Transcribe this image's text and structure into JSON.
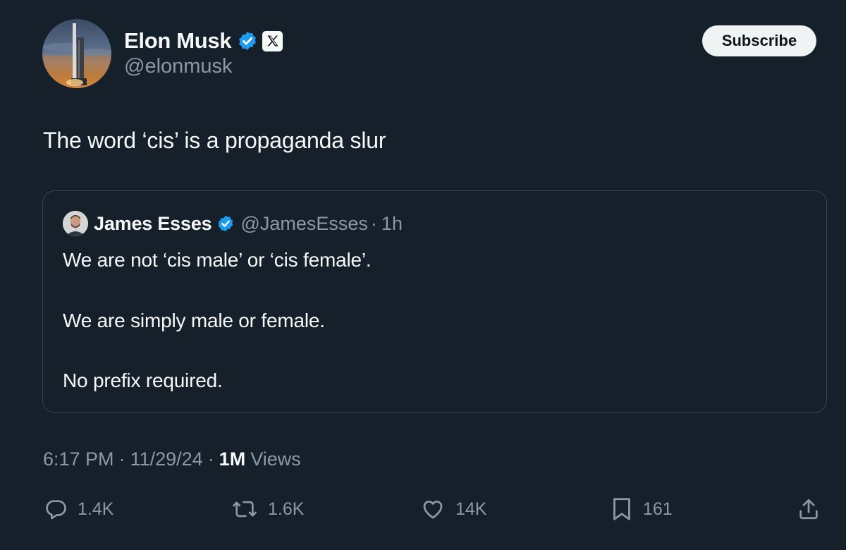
{
  "author": {
    "display_name": "Elon Musk",
    "handle": "@elonmusk",
    "verified_icon": "verified-badge-icon",
    "affiliate_icon": "x-logo-icon"
  },
  "subscribe_label": "Subscribe",
  "tweet": {
    "text": "The word ‘cis’ is a propaganda slur"
  },
  "quote": {
    "display_name": "James Esses",
    "handle": "@JamesEsses",
    "separator": "·",
    "time": "1h",
    "lines": [
      "We are not ‘cis male’ or ‘cis female’.",
      "We are simply male or female.",
      "No prefix required."
    ]
  },
  "meta": {
    "time": "6:17 PM",
    "date": "11/29/24",
    "separator": "·",
    "views_count": "1M",
    "views_label": "Views"
  },
  "actions": {
    "replies": "1.4K",
    "reposts": "1.6K",
    "likes": "14K",
    "bookmarks": "161"
  },
  "colors": {
    "background": "#15202b",
    "text": "#f7f9f9",
    "secondary_text": "#8b98a5",
    "verified_blue": "#1d9bf0",
    "border": "#38444d"
  }
}
